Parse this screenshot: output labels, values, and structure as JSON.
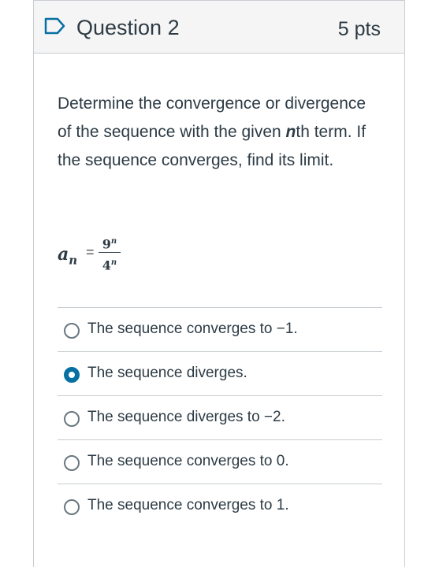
{
  "question": {
    "title": "Question 2",
    "points": "5 pts",
    "icon": "flag-outline-icon",
    "accent_color": "#0770a3"
  },
  "prompt": {
    "part1": "Determine the convergence or divergence of the sequence with the given ",
    "bold_n": "n",
    "part2": "th term. If the sequence converges, find its limit."
  },
  "formula": {
    "lhs": "a",
    "lhs_sub": "n",
    "eq": "=",
    "num_base": "9",
    "num_exp": "n",
    "den_base": "4",
    "den_exp": "n"
  },
  "answers": [
    {
      "label": "The sequence converges to −1.",
      "selected": false
    },
    {
      "label": "The sequence diverges.",
      "selected": true
    },
    {
      "label": "The sequence diverges to −2.",
      "selected": false
    },
    {
      "label": "The sequence converges to 0.",
      "selected": false
    },
    {
      "label": "The sequence converges to 1.",
      "selected": false
    }
  ]
}
